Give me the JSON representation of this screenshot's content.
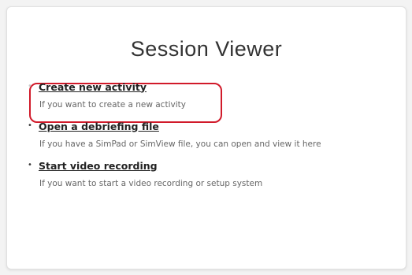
{
  "page": {
    "title": "Session Viewer"
  },
  "activities": [
    {
      "label": "Create new activity",
      "description": "If you want to create a new activity",
      "bullet": "•",
      "bullet_color": "#c9c9c9",
      "highlighted": true
    },
    {
      "label": "Open a debriefing file",
      "description": "If you have a SimPad or SimView file, you can open and view it here",
      "bullet": "•",
      "bullet_color": "#3a3a3a",
      "highlighted": false
    },
    {
      "label": "Start video recording",
      "description": "If you want to start a video recording or setup system",
      "bullet": "•",
      "bullet_color": "#3a3a3a",
      "highlighted": false
    }
  ],
  "colors": {
    "highlight_ring": "#d11a2a",
    "panel_background": "#ffffff",
    "page_background": "#f3f3f3"
  }
}
